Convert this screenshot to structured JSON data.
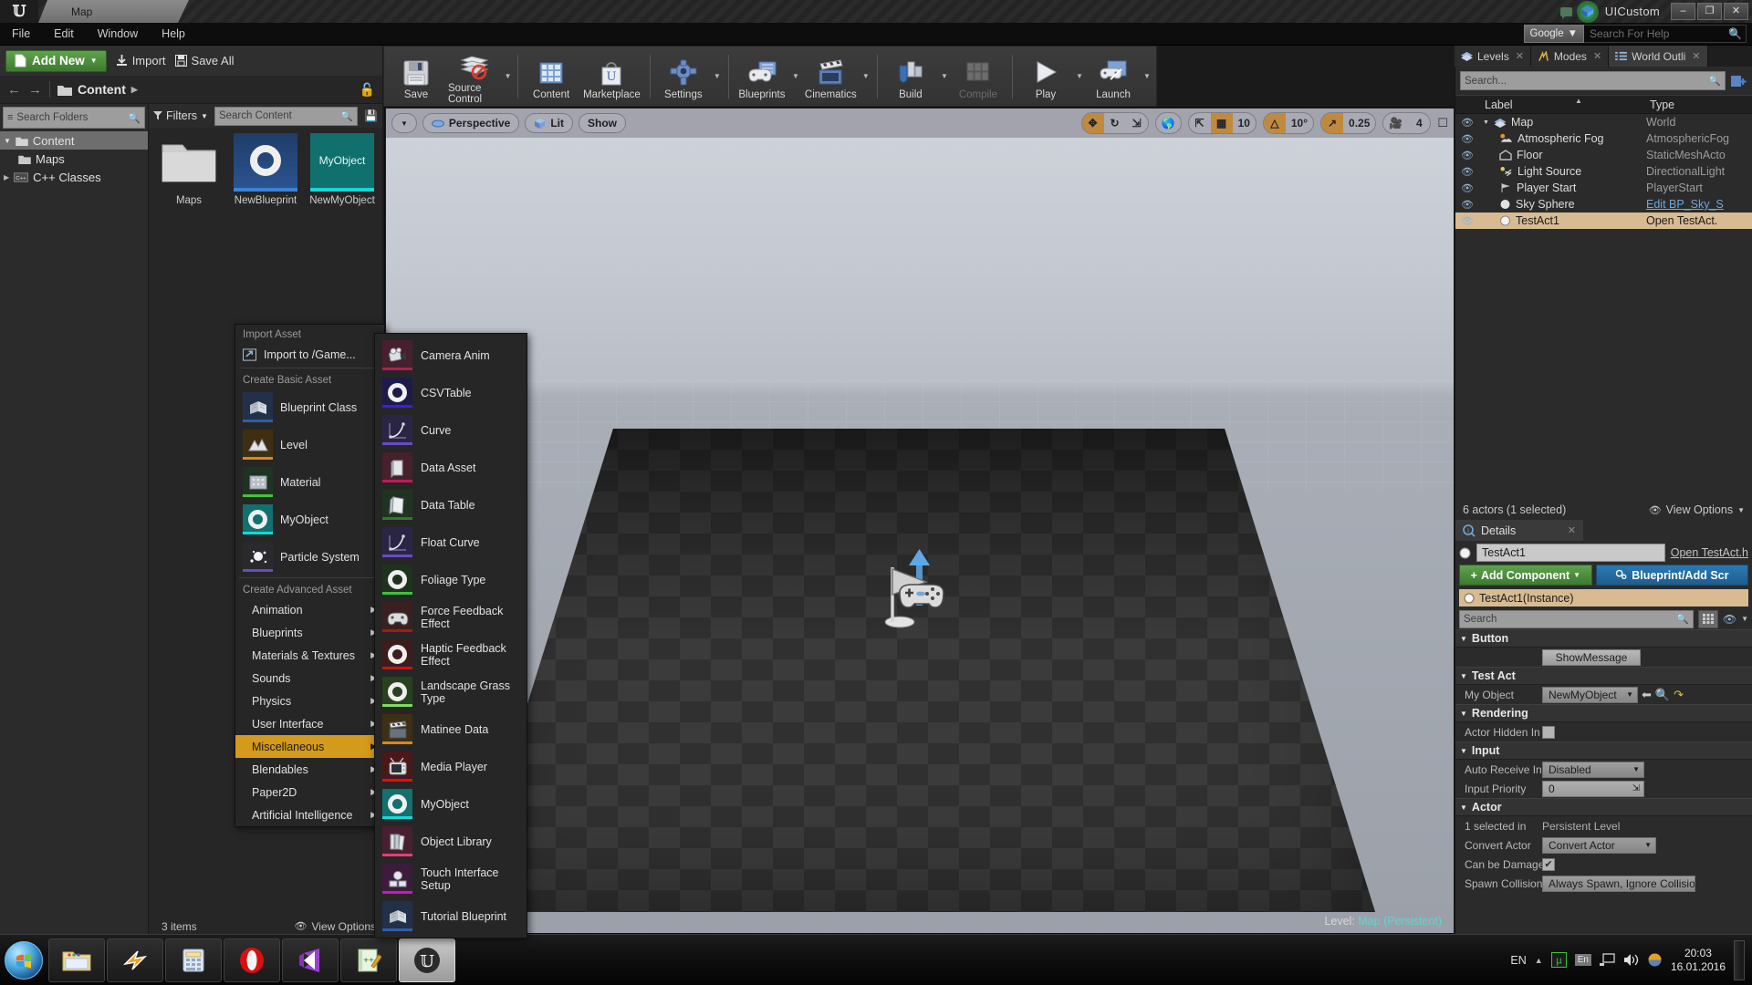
{
  "titlebar": {
    "tab_label": "Map",
    "app_name": "UICustom",
    "logo": "ue-logo",
    "minimize": "–",
    "maximize": "❐",
    "close": "✕"
  },
  "menubar": {
    "items": [
      "File",
      "Edit",
      "Window",
      "Help"
    ],
    "search_engine": "Google",
    "search_placeholder": "Search For Help"
  },
  "toolbar": {
    "items": [
      {
        "label": "Save",
        "icon": "save-icon",
        "caret": false,
        "disabled": false
      },
      {
        "label": "Source Control",
        "icon": "source-control-icon",
        "caret": true,
        "disabled": false
      },
      {
        "label": "Content",
        "icon": "content-icon",
        "caret": false,
        "disabled": false
      },
      {
        "label": "Marketplace",
        "icon": "marketplace-icon",
        "caret": false,
        "disabled": false
      },
      {
        "label": "Settings",
        "icon": "settings-icon",
        "caret": true,
        "disabled": false
      },
      {
        "label": "Blueprints",
        "icon": "blueprints-icon",
        "caret": true,
        "disabled": false
      },
      {
        "label": "Cinematics",
        "icon": "cinematics-icon",
        "caret": true,
        "disabled": false
      },
      {
        "label": "Build",
        "icon": "build-icon",
        "caret": true,
        "disabled": false
      },
      {
        "label": "Compile",
        "icon": "compile-icon",
        "caret": false,
        "disabled": true
      },
      {
        "label": "Play",
        "icon": "play-icon",
        "caret": true,
        "disabled": false
      },
      {
        "label": "Launch",
        "icon": "launch-icon",
        "caret": true,
        "disabled": false
      }
    ]
  },
  "content_browser": {
    "add_new_label": "Add New",
    "import_label": "Import",
    "save_all_label": "Save All",
    "breadcrumb": "Content",
    "folder_search_placeholder": "Search Folders",
    "filters_label": "Filters",
    "asset_search_placeholder": "Search Content",
    "tree": [
      {
        "label": "Content",
        "selected": true,
        "indent": false
      },
      {
        "label": "Maps",
        "selected": false,
        "indent": true
      },
      {
        "label": "C++ Classes",
        "selected": false,
        "indent": false
      }
    ],
    "tiles": [
      {
        "name": "Maps",
        "kind": "folder"
      },
      {
        "name": "NewBlueprint",
        "kind": "blueprint",
        "accent": "#2d5fa8"
      },
      {
        "name": "NewMyObject",
        "kind": "myobject",
        "label": "MyObject",
        "accent": "#17d7d7"
      }
    ],
    "status_items": "3 items",
    "status_view_options": "View Options"
  },
  "viewport": {
    "perspective_label": "Perspective",
    "lit_label": "Lit",
    "show_label": "Show",
    "grid_snap": "10",
    "angle_snap": "10°",
    "scale_snap": "0.25",
    "camera_speed": "4",
    "level_prefix": "Level:",
    "level_name": "Map (Persistent)"
  },
  "right_tabs": [
    {
      "label": "Levels",
      "icon": "levels-icon",
      "active": false
    },
    {
      "label": "Modes",
      "icon": "modes-icon",
      "active": false
    },
    {
      "label": "World Outli",
      "icon": "outliner-icon",
      "active": true
    }
  ],
  "outliner": {
    "search_placeholder": "Search...",
    "col_label": "Label",
    "col_type": "Type",
    "rows": [
      {
        "label": "Map",
        "type": "World",
        "icon": "world-icon",
        "indent": 0,
        "selected": false,
        "link": false
      },
      {
        "label": "Atmospheric Fog",
        "type": "AtmosphericFog",
        "icon": "fog-icon",
        "indent": 1,
        "selected": false,
        "link": false
      },
      {
        "label": "Floor",
        "type": "StaticMeshActo",
        "icon": "mesh-icon",
        "indent": 1,
        "selected": false,
        "link": false
      },
      {
        "label": "Light Source",
        "type": "DirectionalLight",
        "icon": "light-icon",
        "indent": 1,
        "selected": false,
        "link": false
      },
      {
        "label": "Player Start",
        "type": "PlayerStart",
        "icon": "playerstart-icon",
        "indent": 1,
        "selected": false,
        "link": false
      },
      {
        "label": "Sky Sphere",
        "type": "Edit BP_Sky_S",
        "icon": "sphere-icon",
        "indent": 1,
        "selected": false,
        "link": true
      },
      {
        "label": "TestAct1",
        "type": "Open TestAct.",
        "icon": "sphere-icon",
        "indent": 1,
        "selected": true,
        "link": false
      }
    ],
    "footer_count": "6 actors (1 selected)",
    "footer_view_options": "View Options"
  },
  "details": {
    "tab_label": "Details",
    "actor_name": "TestAct1",
    "open_link": "Open TestAct.h",
    "add_component_label": "Add Component",
    "blueprint_label": "Blueprint/Add Scr",
    "instance_label": "TestAct1(Instance)",
    "search_placeholder": "Search",
    "categories": [
      {
        "name": "Button",
        "rows": [
          {
            "label": "",
            "type": "button",
            "value": "ShowMessage"
          }
        ]
      },
      {
        "name": "Test Act",
        "rows": [
          {
            "label": "My Object",
            "type": "asset-combo",
            "value": "NewMyObject"
          }
        ]
      },
      {
        "name": "Rendering",
        "rows": [
          {
            "label": "Actor Hidden In Ga",
            "type": "checkbox",
            "value": ""
          }
        ]
      },
      {
        "name": "Input",
        "rows": [
          {
            "label": "Auto Receive Inpu",
            "type": "combo",
            "value": "Disabled"
          },
          {
            "label": "Input Priority",
            "type": "number",
            "value": "0"
          }
        ]
      },
      {
        "name": "Actor",
        "rows": [
          {
            "label": "1 selected in",
            "type": "static",
            "value": "Persistent Level"
          },
          {
            "label": "Convert Actor",
            "type": "combo",
            "value": "Convert Actor"
          },
          {
            "label": "Can be Damaged",
            "type": "checkbox-checked",
            "value": "✔"
          },
          {
            "label": "Spawn Collision H",
            "type": "combo",
            "value": "Always Spawn, Ignore Collision:"
          }
        ]
      }
    ]
  },
  "context_menu": {
    "import_section": "Import Asset",
    "import_item": "Import to /Game...",
    "basic_section": "Create Basic Asset",
    "basic_items": [
      {
        "label": "Blueprint Class",
        "accent": "#2d5fa8",
        "kind": "blueprint"
      },
      {
        "label": "Level",
        "accent": "#d88a1a",
        "kind": "level"
      },
      {
        "label": "Material",
        "accent": "#4bbf3a",
        "kind": "material"
      },
      {
        "label": "MyObject",
        "accent": "#17d7d7",
        "kind": "ring",
        "ring_bg": "#12706e"
      },
      {
        "label": "Particle System",
        "accent": "#6b4bbf",
        "kind": "particle"
      }
    ],
    "advanced_section": "Create Advanced Asset",
    "advanced_items": [
      {
        "label": "Animation",
        "highlighted": false
      },
      {
        "label": "Blueprints",
        "highlighted": false
      },
      {
        "label": "Materials & Textures",
        "highlighted": false
      },
      {
        "label": "Sounds",
        "highlighted": false
      },
      {
        "label": "Physics",
        "highlighted": false
      },
      {
        "label": "User Interface",
        "highlighted": false
      },
      {
        "label": "Miscellaneous",
        "highlighted": true
      },
      {
        "label": "Blendables",
        "highlighted": false
      },
      {
        "label": "Paper2D",
        "highlighted": false
      },
      {
        "label": "Artificial Intelligence",
        "highlighted": false
      }
    ],
    "submenu_items": [
      {
        "label": "Camera Anim",
        "accent": "#b01f4e",
        "bg": "#47202f",
        "kind": "camera"
      },
      {
        "label": "CSVTable",
        "accent": "#3a1fe0",
        "bg": "#1e1b4a",
        "kind": "ring"
      },
      {
        "label": "Curve",
        "accent": "#6b4bbf",
        "bg": "#2b2545",
        "kind": "curve"
      },
      {
        "label": "Data Asset",
        "accent": "#c2185b",
        "bg": "#46212c",
        "kind": "dataasset"
      },
      {
        "label": "Data Table",
        "accent": "#2f7a2a",
        "bg": "#20331f",
        "kind": "datatable"
      },
      {
        "label": "Float Curve",
        "accent": "#6b4bbf",
        "bg": "#2b2545",
        "kind": "curve"
      },
      {
        "label": "Foliage Type",
        "accent": "#3bc23b",
        "bg": "#1d331d",
        "kind": "ring"
      },
      {
        "label": "Force Feedback Effect",
        "accent": "#b01515",
        "bg": "#3a2020",
        "kind": "gamepad"
      },
      {
        "label": "Haptic Feedback Effect",
        "accent": "#c41616",
        "bg": "#3d1c1c",
        "kind": "ring"
      },
      {
        "label": "Landscape Grass Type",
        "accent": "#7ddc5e",
        "bg": "#27421f",
        "kind": "ring"
      },
      {
        "label": "Matinee Data",
        "accent": "#d88a1a",
        "bg": "#3f2f14",
        "kind": "clapper"
      },
      {
        "label": "Media Player",
        "accent": "#e01010",
        "bg": "#4a1818",
        "kind": "tv"
      },
      {
        "label": "MyObject",
        "accent": "#17d7d7",
        "bg": "#12706e",
        "kind": "ring"
      },
      {
        "label": "Object Library",
        "accent": "#e0407a",
        "bg": "#46202e",
        "kind": "books"
      },
      {
        "label": "Touch Interface Setup",
        "accent": "#c01ac0",
        "bg": "#3c1c3c",
        "kind": "touch"
      },
      {
        "label": "Tutorial Blueprint",
        "accent": "#2d5fa8",
        "bg": "#22304a",
        "kind": "blueprint"
      }
    ]
  },
  "taskbar": {
    "buttons": [
      {
        "name": "explorer",
        "active": false
      },
      {
        "name": "winamp",
        "active": false
      },
      {
        "name": "calculator",
        "active": false
      },
      {
        "name": "opera",
        "active": false
      },
      {
        "name": "visual-studio",
        "active": false
      },
      {
        "name": "notepad-plus-plus",
        "active": false
      },
      {
        "name": "unreal-engine",
        "active": true
      }
    ],
    "tray_lang": "EN",
    "tray_lang2": "En",
    "clock_time": "20:03",
    "clock_date": "16.01.2016"
  }
}
